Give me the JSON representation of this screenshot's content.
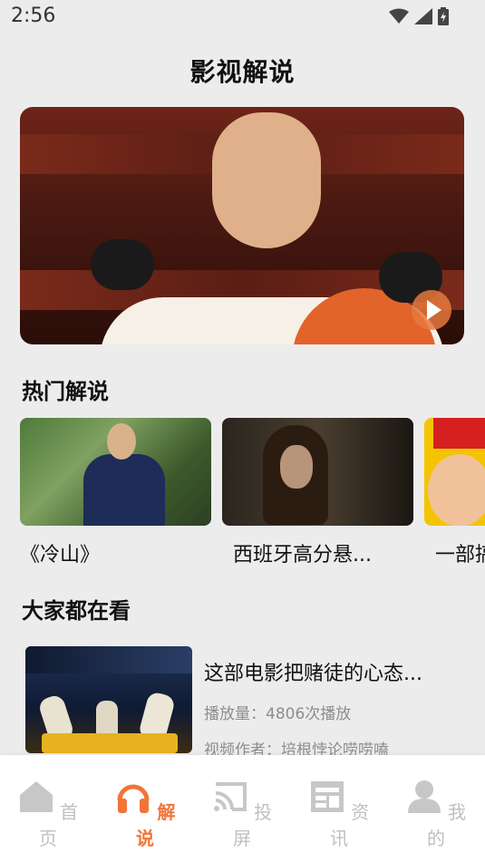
{
  "status": {
    "time": "2:56"
  },
  "header": {
    "title": "影视解说"
  },
  "sections": {
    "hot": "热门解说",
    "watching": "大家都在看"
  },
  "hot": [
    {
      "label": "《冷山》"
    },
    {
      "label": "西班牙高分悬..."
    },
    {
      "label": "一部搞"
    }
  ],
  "list": [
    {
      "title": "这部电影把赌徒的心态...",
      "plays": "播放量：4806次播放",
      "author": "视频作者：培根悖论唠唠嗑"
    }
  ],
  "nav": {
    "items": [
      {
        "label": "首页",
        "icon": "home-icon"
      },
      {
        "label": "解说",
        "icon": "headphones-icon"
      },
      {
        "label": "投屏",
        "icon": "cast-icon"
      },
      {
        "label": "资讯",
        "icon": "news-icon"
      },
      {
        "label": "我的",
        "icon": "person-icon"
      }
    ]
  },
  "colors": {
    "accent": "#f27436",
    "background": "#ececec",
    "inactive": "#bfbfbf"
  }
}
